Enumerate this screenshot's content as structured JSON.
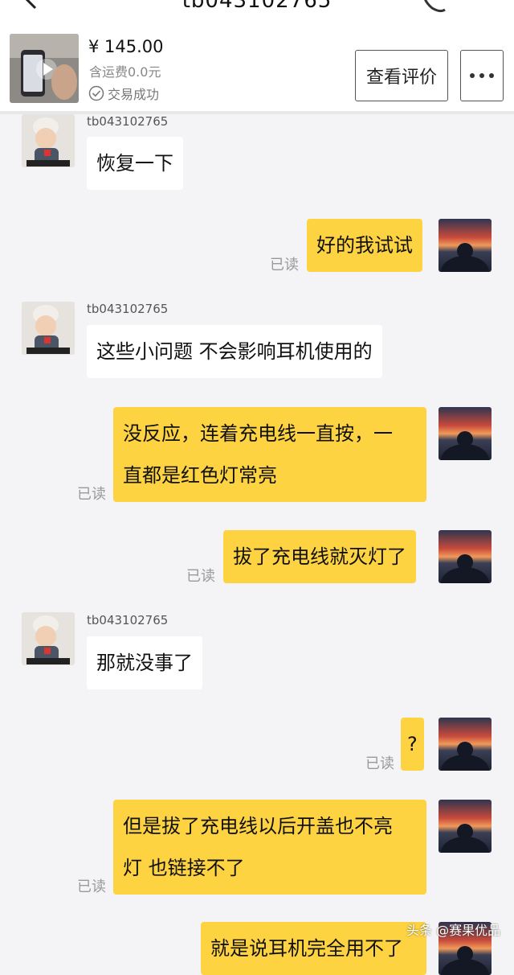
{
  "header": {
    "title": "tb043102765"
  },
  "product": {
    "price": "¥ 145.00",
    "shipping": "含运费0.0元",
    "status": "交易成功",
    "review_label": "查看评价",
    "more_label": "···"
  },
  "chat": {
    "seller_name": "tb043102765",
    "read_label": "已读",
    "messages": [
      {
        "from": "seller",
        "text": "恢复一下"
      },
      {
        "from": "me",
        "text": "好的我试试"
      },
      {
        "from": "seller",
        "text": "这些小问题 不会影响耳机使用的"
      },
      {
        "from": "me",
        "line1": "没反应，连着充电线一直按，一",
        "line2": "直都是红色灯常亮"
      },
      {
        "from": "me",
        "text": "拔了充电线就灭灯了"
      },
      {
        "from": "seller",
        "text": "那就没事了"
      },
      {
        "from": "me",
        "text": "?"
      },
      {
        "from": "me",
        "line1": "但是拔了充电线以后开盖也不亮",
        "line2": "灯 也链接不了"
      },
      {
        "from": "me",
        "text": "就是说耳机完全用不了"
      }
    ]
  },
  "watermark": "头条 @赛果优品",
  "colors": {
    "outgoing_bubble": "#fdd341",
    "incoming_bubble": "#ffffff",
    "background": "#f4f4f6"
  }
}
